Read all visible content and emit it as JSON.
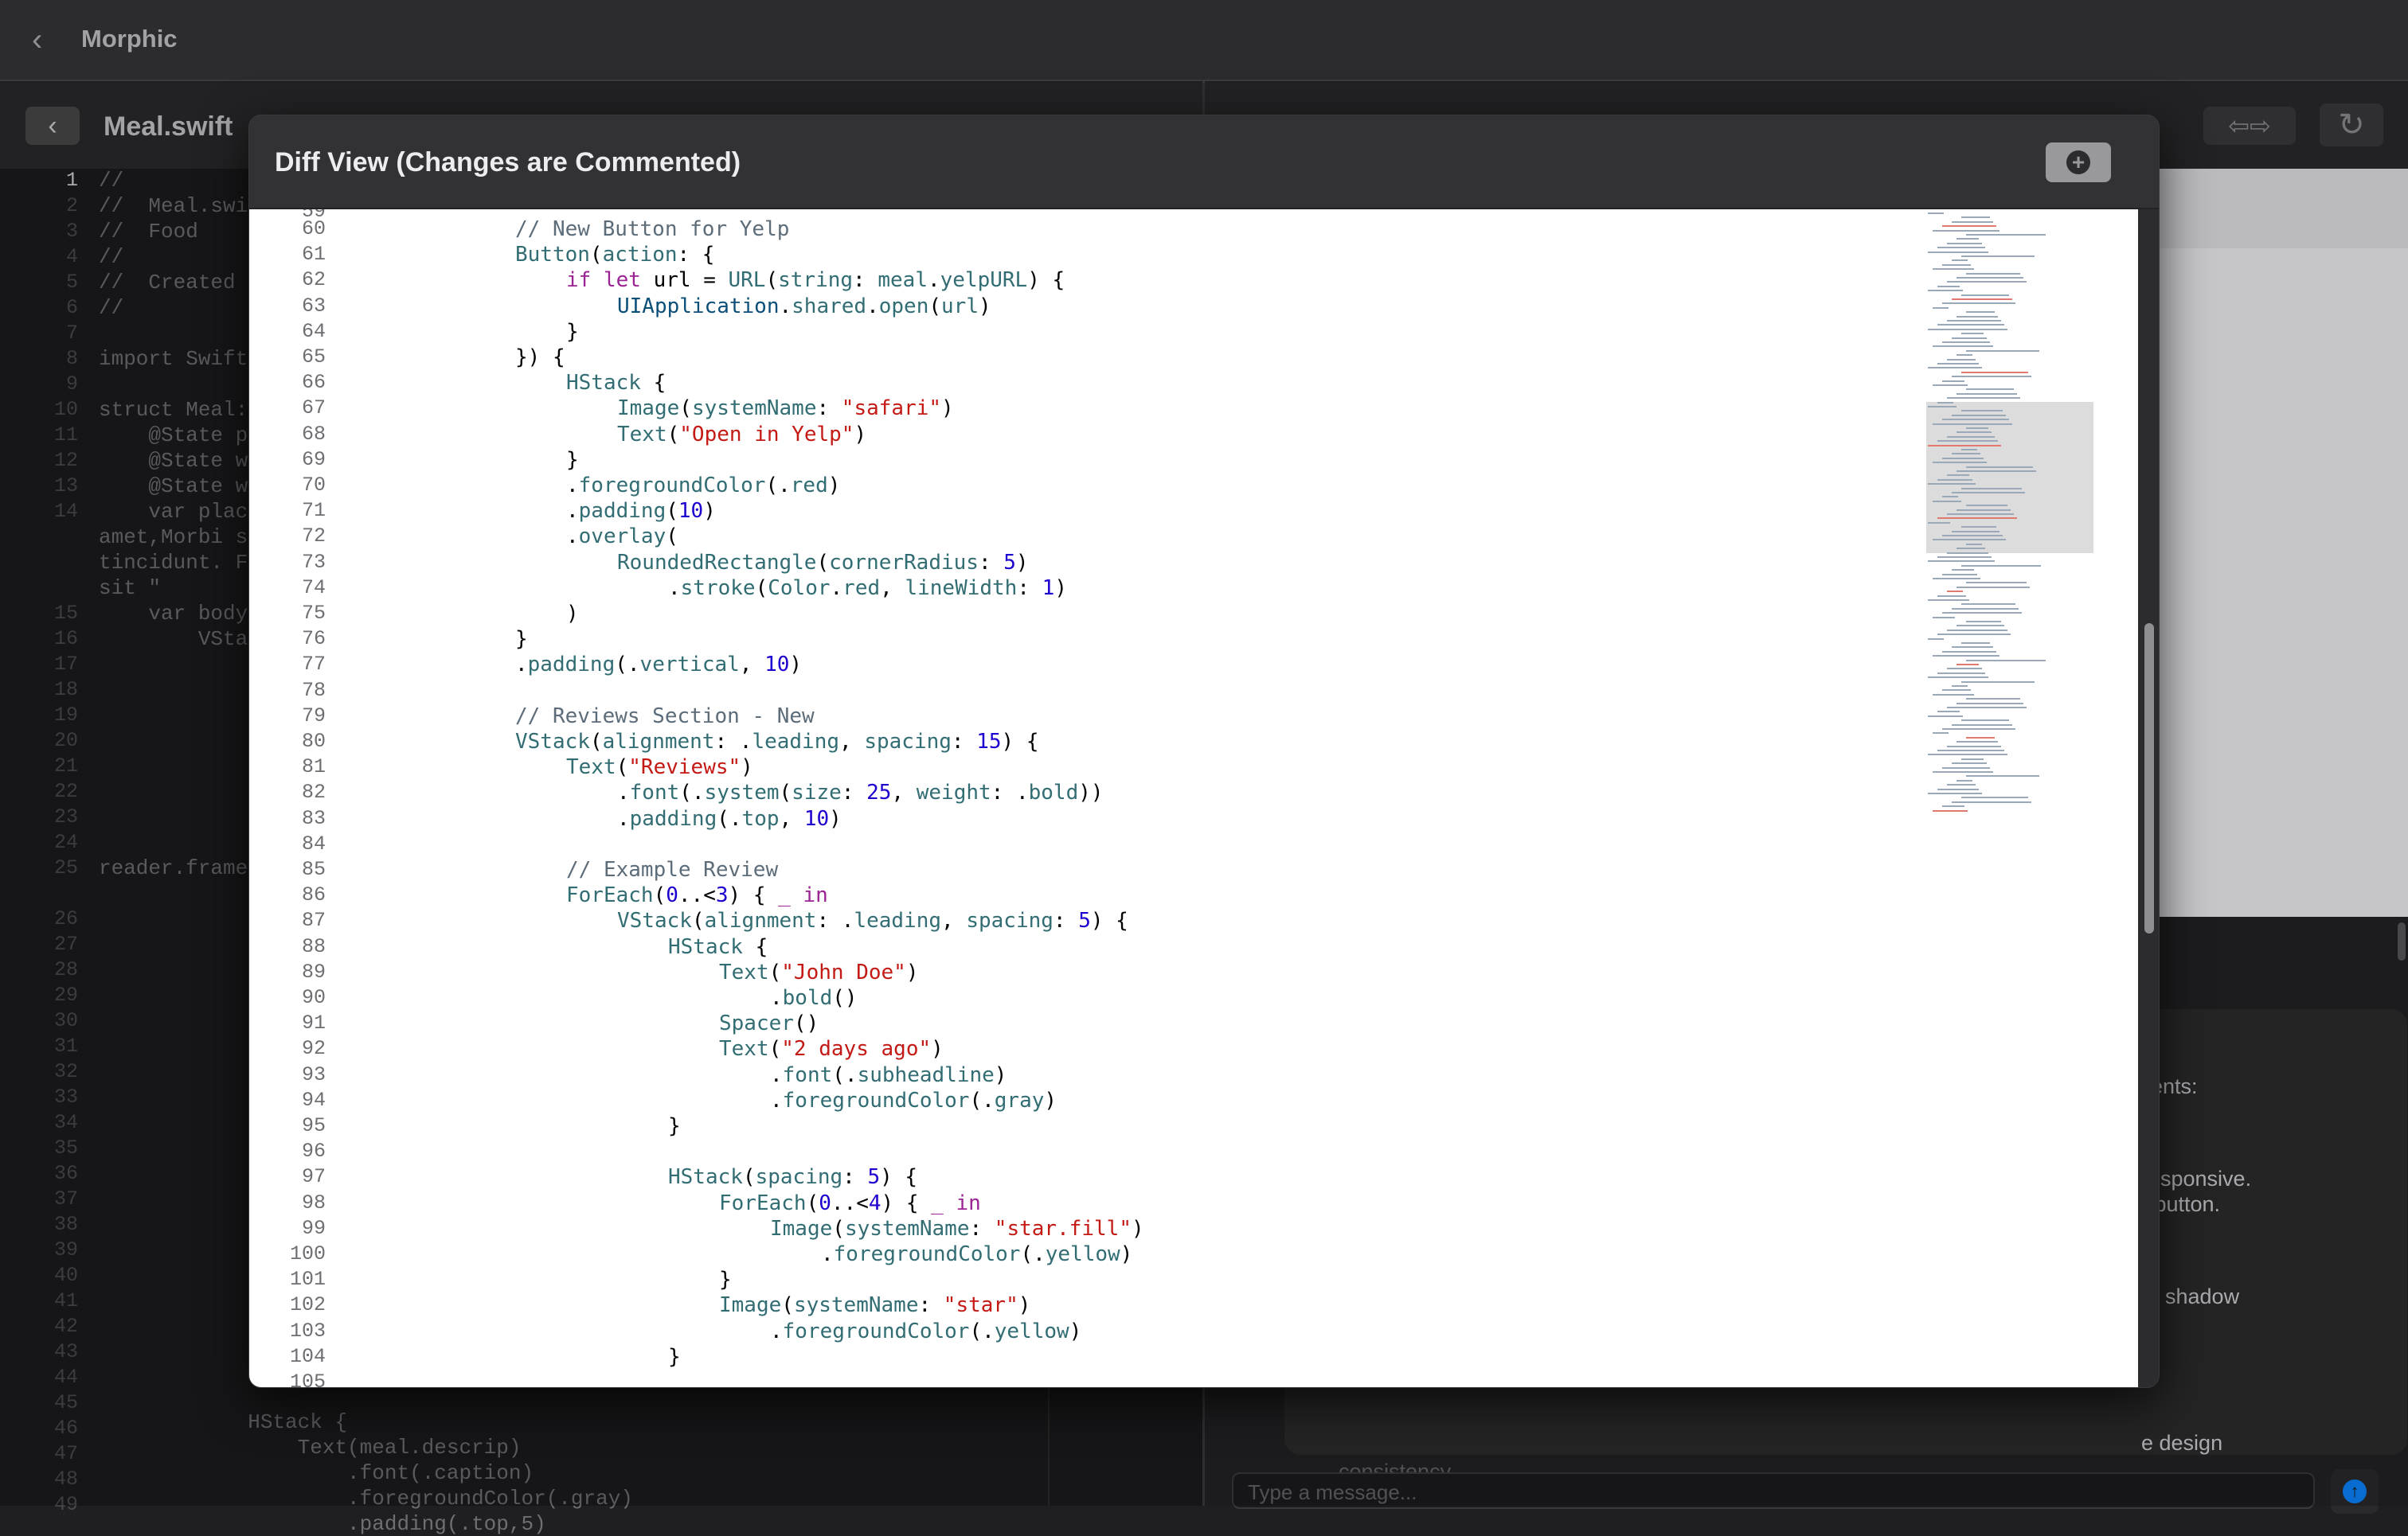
{
  "app": {
    "title": "Morphic",
    "back_icon": "chevron-left-icon"
  },
  "editor": {
    "file_name": "Meal.swift",
    "gutter": [
      "1",
      "2",
      "3",
      "4",
      "5",
      "6",
      "7",
      "8",
      "9",
      "10",
      "11",
      "12",
      "13",
      "14",
      "",
      "",
      "",
      "15",
      "16",
      "17",
      "18",
      "19",
      "20",
      "21",
      "22",
      "23",
      "24",
      "25",
      "",
      "26",
      "27",
      "28",
      "29",
      "30",
      "31",
      "32",
      "33",
      "34",
      "35",
      "36",
      "37",
      "38",
      "39",
      "40",
      "41",
      "42",
      "43",
      "44",
      "45",
      "46",
      "47",
      "48",
      "49"
    ],
    "visible_lines": [
      "//",
      "//  Meal.swi",
      "//  Food",
      "//",
      "//  Created",
      "//",
      "",
      "import Swift",
      "",
      "struct Meal:",
      "    @State p",
      "    @State w",
      "    @State w",
      "    var plac",
      "amet,Morbi s",
      "tincidunt. F",
      "sit \"",
      "    var body",
      "        VSta"
    ],
    "reader_line": "reader.frame",
    "bottom_lines": [
      "            HStack {",
      "                Text(meal.descrip)",
      "                    .font(.caption)",
      "                    .foregroundColor(.gray)",
      "                    .padding(.top,5)"
    ]
  },
  "chat": {
    "fragments": [
      "ents:",
      "responsive.",
      "r button.",
      "shadow",
      "e design",
      "consistency."
    ],
    "input_placeholder": "Type a message..."
  },
  "modal": {
    "title": "Diff View (Changes are Commented)",
    "add_icon": "plus-circle-icon",
    "top_partial_line": "59",
    "bottom_partial_line": "105",
    "lines": [
      {
        "n": "60",
        "i": 6,
        "t": [
          [
            "cm",
            "// New Button for Yelp"
          ]
        ]
      },
      {
        "n": "61",
        "i": 6,
        "t": [
          [
            "fn",
            "Button"
          ],
          [
            "",
            "("
          ],
          [
            "fn",
            "action"
          ],
          [
            "",
            ": {"
          ]
        ]
      },
      {
        "n": "62",
        "i": 8,
        "t": [
          [
            "kw",
            "if let"
          ],
          [
            "",
            " url = "
          ],
          [
            "fn",
            "URL"
          ],
          [
            "",
            "("
          ],
          [
            "fn",
            "string"
          ],
          [
            "",
            ": "
          ],
          [
            "fn",
            "meal"
          ],
          [
            "",
            "."
          ],
          [
            "fn",
            "yelpURL"
          ],
          [
            "",
            ") {"
          ]
        ]
      },
      {
        "n": "63",
        "i": 10,
        "t": [
          [
            "ty",
            "UIApplication"
          ],
          [
            "",
            "."
          ],
          [
            "fn",
            "shared"
          ],
          [
            "",
            "."
          ],
          [
            "fn",
            "open"
          ],
          [
            "",
            "("
          ],
          [
            "fn",
            "url"
          ],
          [
            "",
            ")"
          ]
        ]
      },
      {
        "n": "64",
        "i": 8,
        "t": [
          [
            "",
            "}"
          ]
        ]
      },
      {
        "n": "65",
        "i": 6,
        "t": [
          [
            "",
            "}) {"
          ]
        ]
      },
      {
        "n": "66",
        "i": 8,
        "t": [
          [
            "fn",
            "HStack"
          ],
          [
            "",
            " {"
          ]
        ]
      },
      {
        "n": "67",
        "i": 10,
        "t": [
          [
            "fn",
            "Image"
          ],
          [
            "",
            "("
          ],
          [
            "fn",
            "systemName"
          ],
          [
            "",
            ": "
          ],
          [
            "st",
            "\"safari\""
          ],
          [
            "",
            ")"
          ]
        ]
      },
      {
        "n": "68",
        "i": 10,
        "t": [
          [
            "fn",
            "Text"
          ],
          [
            "",
            "("
          ],
          [
            "st",
            "\"Open in Yelp\""
          ],
          [
            "",
            ")"
          ]
        ]
      },
      {
        "n": "69",
        "i": 8,
        "t": [
          [
            "",
            "}"
          ]
        ]
      },
      {
        "n": "70",
        "i": 8,
        "t": [
          [
            "",
            "."
          ],
          [
            "fn",
            "foregroundColor"
          ],
          [
            "",
            "(."
          ],
          [
            "fn",
            "red"
          ],
          [
            "",
            ")"
          ]
        ]
      },
      {
        "n": "71",
        "i": 8,
        "t": [
          [
            "",
            "."
          ],
          [
            "fn",
            "padding"
          ],
          [
            "",
            "("
          ],
          [
            "nu",
            "10"
          ],
          [
            "",
            ")"
          ]
        ]
      },
      {
        "n": "72",
        "i": 8,
        "t": [
          [
            "",
            "."
          ],
          [
            "fn",
            "overlay"
          ],
          [
            "",
            "("
          ]
        ]
      },
      {
        "n": "73",
        "i": 10,
        "t": [
          [
            "fn",
            "RoundedRectangle"
          ],
          [
            "",
            "("
          ],
          [
            "fn",
            "cornerRadius"
          ],
          [
            "",
            ": "
          ],
          [
            "nu",
            "5"
          ],
          [
            "",
            ")"
          ]
        ]
      },
      {
        "n": "74",
        "i": 12,
        "t": [
          [
            "",
            "."
          ],
          [
            "fn",
            "stroke"
          ],
          [
            "",
            "("
          ],
          [
            "fn",
            "Color"
          ],
          [
            "",
            "."
          ],
          [
            "fn",
            "red"
          ],
          [
            "",
            ", "
          ],
          [
            "fn",
            "lineWidth"
          ],
          [
            "",
            ": "
          ],
          [
            "nu",
            "1"
          ],
          [
            "",
            ")"
          ]
        ]
      },
      {
        "n": "75",
        "i": 8,
        "t": [
          [
            "",
            ")"
          ]
        ]
      },
      {
        "n": "76",
        "i": 6,
        "t": [
          [
            "",
            "}"
          ]
        ]
      },
      {
        "n": "77",
        "i": 6,
        "t": [
          [
            "",
            "."
          ],
          [
            "fn",
            "padding"
          ],
          [
            "",
            "(."
          ],
          [
            "fn",
            "vertical"
          ],
          [
            "",
            ", "
          ],
          [
            "nu",
            "10"
          ],
          [
            "",
            ")"
          ]
        ]
      },
      {
        "n": "78",
        "i": 0,
        "t": []
      },
      {
        "n": "79",
        "i": 6,
        "t": [
          [
            "cm",
            "// Reviews Section - New"
          ]
        ]
      },
      {
        "n": "80",
        "i": 6,
        "t": [
          [
            "fn",
            "VStack"
          ],
          [
            "",
            "("
          ],
          [
            "fn",
            "alignment"
          ],
          [
            "",
            ": ."
          ],
          [
            "fn",
            "leading"
          ],
          [
            "",
            ", "
          ],
          [
            "fn",
            "spacing"
          ],
          [
            "",
            ": "
          ],
          [
            "nu",
            "15"
          ],
          [
            "",
            ") {"
          ]
        ]
      },
      {
        "n": "81",
        "i": 8,
        "t": [
          [
            "fn",
            "Text"
          ],
          [
            "",
            "("
          ],
          [
            "st",
            "\"Reviews\""
          ],
          [
            "",
            ")"
          ]
        ]
      },
      {
        "n": "82",
        "i": 10,
        "t": [
          [
            "",
            "."
          ],
          [
            "fn",
            "font"
          ],
          [
            "",
            "(."
          ],
          [
            "fn",
            "system"
          ],
          [
            "",
            "("
          ],
          [
            "fn",
            "size"
          ],
          [
            "",
            ": "
          ],
          [
            "nu",
            "25"
          ],
          [
            "",
            ", "
          ],
          [
            "fn",
            "weight"
          ],
          [
            "",
            ": ."
          ],
          [
            "fn",
            "bold"
          ],
          [
            "",
            "))"
          ]
        ]
      },
      {
        "n": "83",
        "i": 10,
        "t": [
          [
            "",
            "."
          ],
          [
            "fn",
            "padding"
          ],
          [
            "",
            "(."
          ],
          [
            "fn",
            "top"
          ],
          [
            "",
            ", "
          ],
          [
            "nu",
            "10"
          ],
          [
            "",
            ")"
          ]
        ]
      },
      {
        "n": "84",
        "i": 0,
        "t": []
      },
      {
        "n": "85",
        "i": 8,
        "t": [
          [
            "cm",
            "// Example Review"
          ]
        ]
      },
      {
        "n": "86",
        "i": 8,
        "t": [
          [
            "fn",
            "ForEach"
          ],
          [
            "",
            "("
          ],
          [
            "nu",
            "0"
          ],
          [
            "",
            "..<"
          ],
          [
            "nu",
            "3"
          ],
          [
            "",
            ") { "
          ],
          [
            "kw",
            "_"
          ],
          [
            "",
            " "
          ],
          [
            "kw",
            "in"
          ]
        ]
      },
      {
        "n": "87",
        "i": 10,
        "t": [
          [
            "fn",
            "VStack"
          ],
          [
            "",
            "("
          ],
          [
            "fn",
            "alignment"
          ],
          [
            "",
            ": ."
          ],
          [
            "fn",
            "leading"
          ],
          [
            "",
            ", "
          ],
          [
            "fn",
            "spacing"
          ],
          [
            "",
            ": "
          ],
          [
            "nu",
            "5"
          ],
          [
            "",
            ") {"
          ]
        ]
      },
      {
        "n": "88",
        "i": 12,
        "t": [
          [
            "fn",
            "HStack"
          ],
          [
            "",
            " {"
          ]
        ]
      },
      {
        "n": "89",
        "i": 14,
        "t": [
          [
            "fn",
            "Text"
          ],
          [
            "",
            "("
          ],
          [
            "st",
            "\"John Doe\""
          ],
          [
            "",
            ")"
          ]
        ]
      },
      {
        "n": "90",
        "i": 16,
        "t": [
          [
            "",
            "."
          ],
          [
            "fn",
            "bold"
          ],
          [
            "",
            "()"
          ]
        ]
      },
      {
        "n": "91",
        "i": 14,
        "t": [
          [
            "fn",
            "Spacer"
          ],
          [
            "",
            "()"
          ]
        ]
      },
      {
        "n": "92",
        "i": 14,
        "t": [
          [
            "fn",
            "Text"
          ],
          [
            "",
            "("
          ],
          [
            "st",
            "\"2 days ago\""
          ],
          [
            "",
            ")"
          ]
        ]
      },
      {
        "n": "93",
        "i": 16,
        "t": [
          [
            "",
            "."
          ],
          [
            "fn",
            "font"
          ],
          [
            "",
            "(."
          ],
          [
            "fn",
            "subheadline"
          ],
          [
            "",
            ")"
          ]
        ]
      },
      {
        "n": "94",
        "i": 16,
        "t": [
          [
            "",
            "."
          ],
          [
            "fn",
            "foregroundColor"
          ],
          [
            "",
            "(."
          ],
          [
            "fn",
            "gray"
          ],
          [
            "",
            ")"
          ]
        ]
      },
      {
        "n": "95",
        "i": 12,
        "t": [
          [
            "",
            "}"
          ]
        ]
      },
      {
        "n": "96",
        "i": 0,
        "t": []
      },
      {
        "n": "97",
        "i": 12,
        "t": [
          [
            "fn",
            "HStack"
          ],
          [
            "",
            "("
          ],
          [
            "fn",
            "spacing"
          ],
          [
            "",
            ": "
          ],
          [
            "nu",
            "5"
          ],
          [
            "",
            ") {"
          ]
        ]
      },
      {
        "n": "98",
        "i": 14,
        "t": [
          [
            "fn",
            "ForEach"
          ],
          [
            "",
            "("
          ],
          [
            "nu",
            "0"
          ],
          [
            "",
            "..<"
          ],
          [
            "nu",
            "4"
          ],
          [
            "",
            ") { "
          ],
          [
            "kw",
            "_"
          ],
          [
            "",
            " "
          ],
          [
            "kw",
            "in"
          ]
        ]
      },
      {
        "n": "99",
        "i": 16,
        "t": [
          [
            "fn",
            "Image"
          ],
          [
            "",
            "("
          ],
          [
            "fn",
            "systemName"
          ],
          [
            "",
            ": "
          ],
          [
            "st",
            "\"star.fill\""
          ],
          [
            "",
            ")"
          ]
        ]
      },
      {
        "n": "100",
        "i": 18,
        "t": [
          [
            "",
            "."
          ],
          [
            "fn",
            "foregroundColor"
          ],
          [
            "",
            "(."
          ],
          [
            "fn",
            "yellow"
          ],
          [
            "",
            ")"
          ]
        ]
      },
      {
        "n": "101",
        "i": 14,
        "t": [
          [
            "",
            "}"
          ]
        ]
      },
      {
        "n": "102",
        "i": 14,
        "t": [
          [
            "fn",
            "Image"
          ],
          [
            "",
            "("
          ],
          [
            "fn",
            "systemName"
          ],
          [
            "",
            ": "
          ],
          [
            "st",
            "\"star\""
          ],
          [
            "",
            ")"
          ]
        ]
      },
      {
        "n": "103",
        "i": 16,
        "t": [
          [
            "",
            "."
          ],
          [
            "fn",
            "foregroundColor"
          ],
          [
            "",
            "(."
          ],
          [
            "fn",
            "yellow"
          ],
          [
            "",
            ")"
          ]
        ]
      },
      {
        "n": "104",
        "i": 12,
        "t": [
          [
            "",
            "}"
          ]
        ]
      }
    ]
  },
  "colors": {
    "comment": "#5d6c79",
    "keyword": "#9b2393",
    "string": "#c41a16",
    "number": "#1c00cf",
    "identifier": "#326d74",
    "accent": "#0a84ff"
  }
}
